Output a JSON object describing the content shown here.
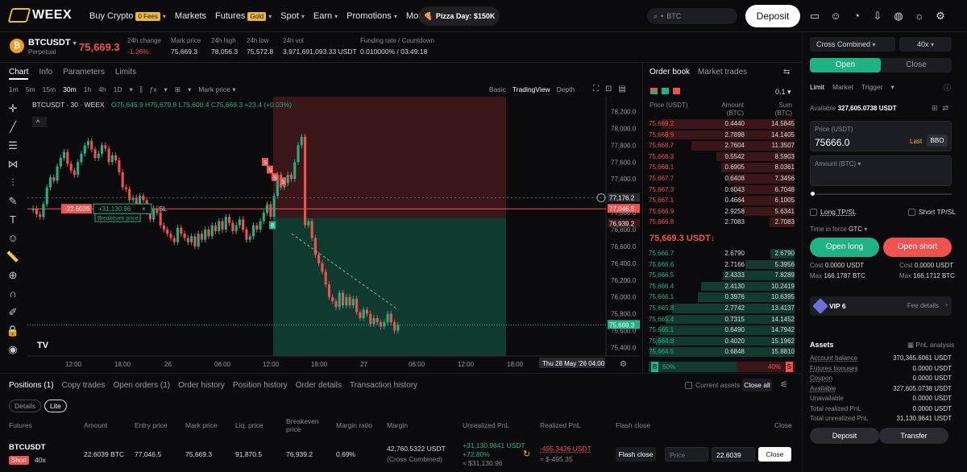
{
  "brand": {
    "name": "WEEX"
  },
  "nav": [
    {
      "label": "Buy Crypto",
      "tag": "0 Fees",
      "chev": true
    },
    {
      "label": "Markets"
    },
    {
      "label": "Futures",
      "tag": "Gold",
      "chev": true
    },
    {
      "label": "Spot",
      "chev": true
    },
    {
      "label": "Earn",
      "chev": true
    },
    {
      "label": "Promotions",
      "chev": true
    },
    {
      "label": "More",
      "chev": true
    }
  ],
  "promo": "Pizza Day: $150K",
  "search": {
    "placeholder": "BTC"
  },
  "deposit_label": "Deposit",
  "ticker": {
    "symbol": "BTCUSDT",
    "type": "Perpetual",
    "last": "75,669.3",
    "stats": [
      {
        "label": "24h change",
        "value": "-1.26%",
        "neg": true
      },
      {
        "label": "Mark price",
        "value": "75,669.3"
      },
      {
        "label": "24h high",
        "value": "78,056.3"
      },
      {
        "label": "24h low",
        "value": "75,572.8"
      },
      {
        "label": "24h vol",
        "value": "3,971,691,093.33 USDT"
      },
      {
        "label": "Funding rate / Countdown",
        "value": "0.010000% / 03:49:18"
      }
    ]
  },
  "chart_tabs": [
    "Chart",
    "Info",
    "Parameters",
    "Limits"
  ],
  "intervals": [
    "1m",
    "5m",
    "15m",
    "30m",
    "1h",
    "4h",
    "1D"
  ],
  "mark_price_label": "Mark price",
  "views": [
    "Basic",
    "TradingView",
    "Depth"
  ],
  "chart_data": {
    "type": "candlestick",
    "symbol_line": "BTCUSDT · 30 · WEEX",
    "ohlc": "O75,645.9 H75,679.8 L75,600.4 C75,669.3 +23.4 (+0.03%)",
    "yticks": [
      "78,200.0",
      "78,000.0",
      "77,800.0",
      "77,600.0",
      "77,400.0",
      "77,200.0",
      "77,000.0",
      "76,800.0",
      "76,600.0",
      "76,400.0",
      "76,200.0",
      "76,000.0",
      "75,800.0",
      "75,600.0",
      "75,400.0"
    ],
    "xticks": [
      "12:00",
      "18:00",
      "26",
      "06:00",
      "12:00",
      "18:00",
      "27",
      "06:00",
      "12:00",
      "18:00"
    ],
    "ylim": [
      75300,
      78300
    ],
    "price_tags": [
      {
        "label": "77,176.2",
        "value": 77176.2
      },
      {
        "label": "77,046.5",
        "value": 77046.5
      },
      {
        "label": "76,939.2",
        "value": 76939.2
      },
      {
        "label": "75,669.3",
        "value": 75669.3
      }
    ],
    "position_label": {
      "qty": "-22.6039",
      "pnl": "+31,130.96",
      "x": "×",
      "side": "SL",
      "breakeven": "Breakeven price"
    },
    "time_label": "Thu 28 May '26  04:00",
    "closes": [
      77050,
      76980,
      76950,
      77100,
      77300,
      77420,
      77380,
      77550,
      77650,
      77720,
      77580,
      77500,
      77450,
      77600,
      77700,
      77800,
      77850,
      77750,
      77650,
      77700,
      77800,
      77760,
      77600,
      77680,
      77620,
      77480,
      77300,
      77280,
      77150,
      77180,
      77050,
      77200,
      77150,
      77010,
      76920,
      77050,
      77000,
      76850,
      76800,
      76750,
      76700,
      76650,
      76820,
      76750,
      76700,
      76650,
      76720,
      76600,
      76750,
      76680,
      76800,
      76720,
      76850,
      76780,
      76900,
      76800,
      76950,
      76880,
      76780,
      76850,
      76920,
      76800,
      76680,
      76720,
      76850,
      76800,
      76900,
      77000,
      77100,
      76950,
      77200,
      77450,
      77300,
      77350,
      77450,
      77400,
      77600,
      77800,
      77900,
      76850,
      76900,
      76700,
      76500,
      76400,
      76300,
      76150,
      76000,
      75950,
      75880,
      76050,
      75900,
      76000,
      75900,
      75980,
      75820,
      75750,
      75850,
      75800,
      75680,
      75750,
      75700,
      75650,
      75700,
      75800,
      75700,
      75600,
      75669
    ]
  },
  "orderbook": {
    "tabs": [
      "Order book",
      "Market trades"
    ],
    "step": "0.1",
    "headers": [
      "Price (USDT)",
      "Amount (BTC)",
      "Sum (BTC)"
    ],
    "asks": [
      [
        "75,669.2",
        "0.4440",
        "14.5845"
      ],
      [
        "75,668.9",
        "2.7898",
        "14.1405"
      ],
      [
        "75,668.7",
        "2.7604",
        "11.3507"
      ],
      [
        "75,668.3",
        "0.5542",
        "8.5903"
      ],
      [
        "75,668.1",
        "0.6905",
        "8.0361"
      ],
      [
        "75,667.7",
        "0.6408",
        "7.3456"
      ],
      [
        "75,667.3",
        "0.6043",
        "6.7048"
      ],
      [
        "75,667.1",
        "0.4664",
        "6.1005"
      ],
      [
        "75,666.9",
        "2.9258",
        "5.6341"
      ],
      [
        "75,666.8",
        "2.7083",
        "2.7083"
      ]
    ],
    "mid": "75,669.3 USDT↓",
    "bids": [
      [
        "75,666.7",
        "2.6790",
        "2.6790"
      ],
      [
        "75,666.6",
        "2.7166",
        "5.3956"
      ],
      [
        "75,666.5",
        "2.4333",
        "7.8289"
      ],
      [
        "75,666.4",
        "2.4130",
        "10.2419"
      ],
      [
        "75,666.1",
        "0.3976",
        "10.6395"
      ],
      [
        "75,665.8",
        "2.7742",
        "13.4137"
      ],
      [
        "75,665.4",
        "0.7315",
        "14.1452"
      ],
      [
        "75,665.1",
        "0.6490",
        "14.7942"
      ],
      [
        "75,664.8",
        "0.4020",
        "15.1962"
      ],
      [
        "75,664.5",
        "0.6848",
        "15.8810"
      ]
    ],
    "ratio": {
      "buy_label": "B",
      "buy": "60%",
      "sell_label": "S",
      "sell": "40%",
      "buy_frac": 0.6
    }
  },
  "order": {
    "margin_mode": "Cross Combined",
    "leverage": "40x",
    "open": "Open",
    "close": "Close",
    "types": [
      "Limit",
      "Market",
      "Trigger"
    ],
    "available_label": "Available",
    "available": "327,605.0738 USDT",
    "price_label": "Price (USDT)",
    "price": "75666.0",
    "last": "Last",
    "bbo": "BBO",
    "amount_label": "Amount (BTC)",
    "long_tpsl": "Long TP/SL",
    "short_tpsl": "Short TP/SL",
    "tif_label": "Time in force",
    "tif": "GTC",
    "open_long": "Open long",
    "open_short": "Open short",
    "cost_long": "0.0000 USDT",
    "cost_short": "0.0000 USDT",
    "max_long": "166.1787 BTC",
    "max_short": "166.1712 BTC",
    "cost_label": "Cost",
    "max_label": "Max",
    "vip": "VIP 6",
    "fee": "Fee details"
  },
  "assets": {
    "title": "Assets",
    "pnl_analysis": "PnL analysis",
    "rows": [
      [
        "Account balance",
        "370,365.6061 USDT"
      ],
      [
        "Futures bonuses",
        "0.0000 USDT"
      ],
      [
        "Coupon",
        "0.0000 USDT"
      ],
      [
        "Available",
        "327,605.0738 USDT"
      ],
      [
        "Unavailable",
        "0.0000 USDT"
      ],
      [
        "Total realized PnL",
        "0.0000 USDT"
      ],
      [
        "Total unrealized PnL",
        "31,130.9641 USDT"
      ]
    ],
    "deposit": "Deposit",
    "transfer": "Transfer"
  },
  "positions": {
    "tabs": [
      "Positions (1)",
      "Copy trades",
      "Open orders (1)",
      "Order history",
      "Position history",
      "Order details",
      "Transaction history"
    ],
    "details": "Details",
    "lite": "Lite",
    "current_assets": "Current assets",
    "close_all": "Close all",
    "headers": [
      "Futures",
      "Amount",
      "Entry price",
      "Mark price",
      "Liq. price",
      "Breakeven price",
      "Margin ratio",
      "Margin",
      "Unrealized PnL",
      "Realized PnL",
      "Flash close",
      "Close"
    ],
    "row": {
      "symbol": "BTCUSDT",
      "side": "Short",
      "lev": "40x",
      "amount": "22.6039 BTC",
      "entry": "77,046.5",
      "mark": "75,669.3",
      "liq": "91,870.5",
      "breakeven": "76,939.2",
      "mratio": "0.69%",
      "margin": "42,760.5322 USDT",
      "margin_mode": "(Cross Combined)",
      "upnl": "+31,130.9641 USDT",
      "upnl_pct": "+72.80%",
      "upnl_approx": "≈ $31,130.96",
      "rpnl": "-495.3426 USDT",
      "rpnl_approx": "≈ $-495.35",
      "flash": "Flash close",
      "price_ph": "Price",
      "qty": "22.6039",
      "close": "Close"
    }
  }
}
